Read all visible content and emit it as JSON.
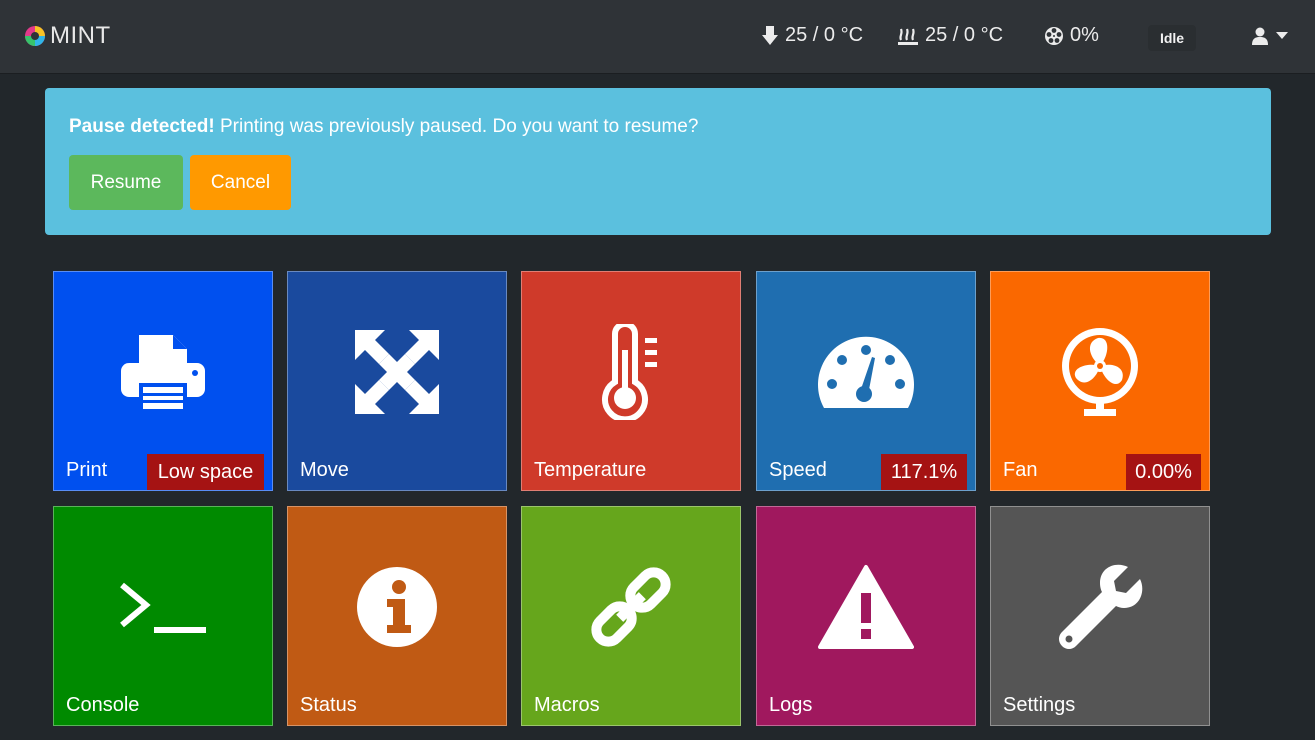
{
  "app": {
    "title": "MINT"
  },
  "navbar": {
    "extruder_temp": "25 / 0 °C",
    "bed_temp": "25 / 0 °C",
    "progress": "0%",
    "status": "Idle",
    "icons": {
      "extruder": "extruder-icon",
      "bed": "heated-bed-icon",
      "progress": "film-reel-icon",
      "user": "user-icon",
      "caret": "caret-down-icon"
    }
  },
  "alert": {
    "title": "Pause detected!",
    "message": " Printing was previously paused. Do you want to resume?",
    "resume_label": "Resume",
    "cancel_label": "Cancel"
  },
  "tiles": [
    {
      "label": "Print",
      "badge": "Low space",
      "icon": "printer-icon",
      "color": "#0050ef"
    },
    {
      "label": "Move",
      "icon": "arrows-expand-icon",
      "color": "#1a4a9e"
    },
    {
      "label": "Temperature",
      "icon": "thermometer-icon",
      "color": "#cf3a2a"
    },
    {
      "label": "Speed",
      "badge": "117.1%",
      "icon": "speedometer-icon",
      "color": "#1f6eb0"
    },
    {
      "label": "Fan",
      "badge": "0.00%",
      "icon": "fan-icon",
      "color": "#fa6800"
    },
    {
      "label": "Console",
      "icon": "terminal-icon",
      "color": "#008a00"
    },
    {
      "label": "Status",
      "icon": "info-icon",
      "color": "#c05a14"
    },
    {
      "label": "Macros",
      "icon": "link-icon",
      "color": "#66a61c"
    },
    {
      "label": "Logs",
      "icon": "warning-icon",
      "color": "#a0185e"
    },
    {
      "label": "Settings",
      "icon": "wrench-icon",
      "color": "#555555"
    }
  ],
  "colors": {
    "navbar": "#2f3337",
    "background": "#22272b",
    "alert": "#5bc0de",
    "resume": "#5cb85c",
    "cancel": "#ff9900",
    "badge": "#a51313"
  }
}
